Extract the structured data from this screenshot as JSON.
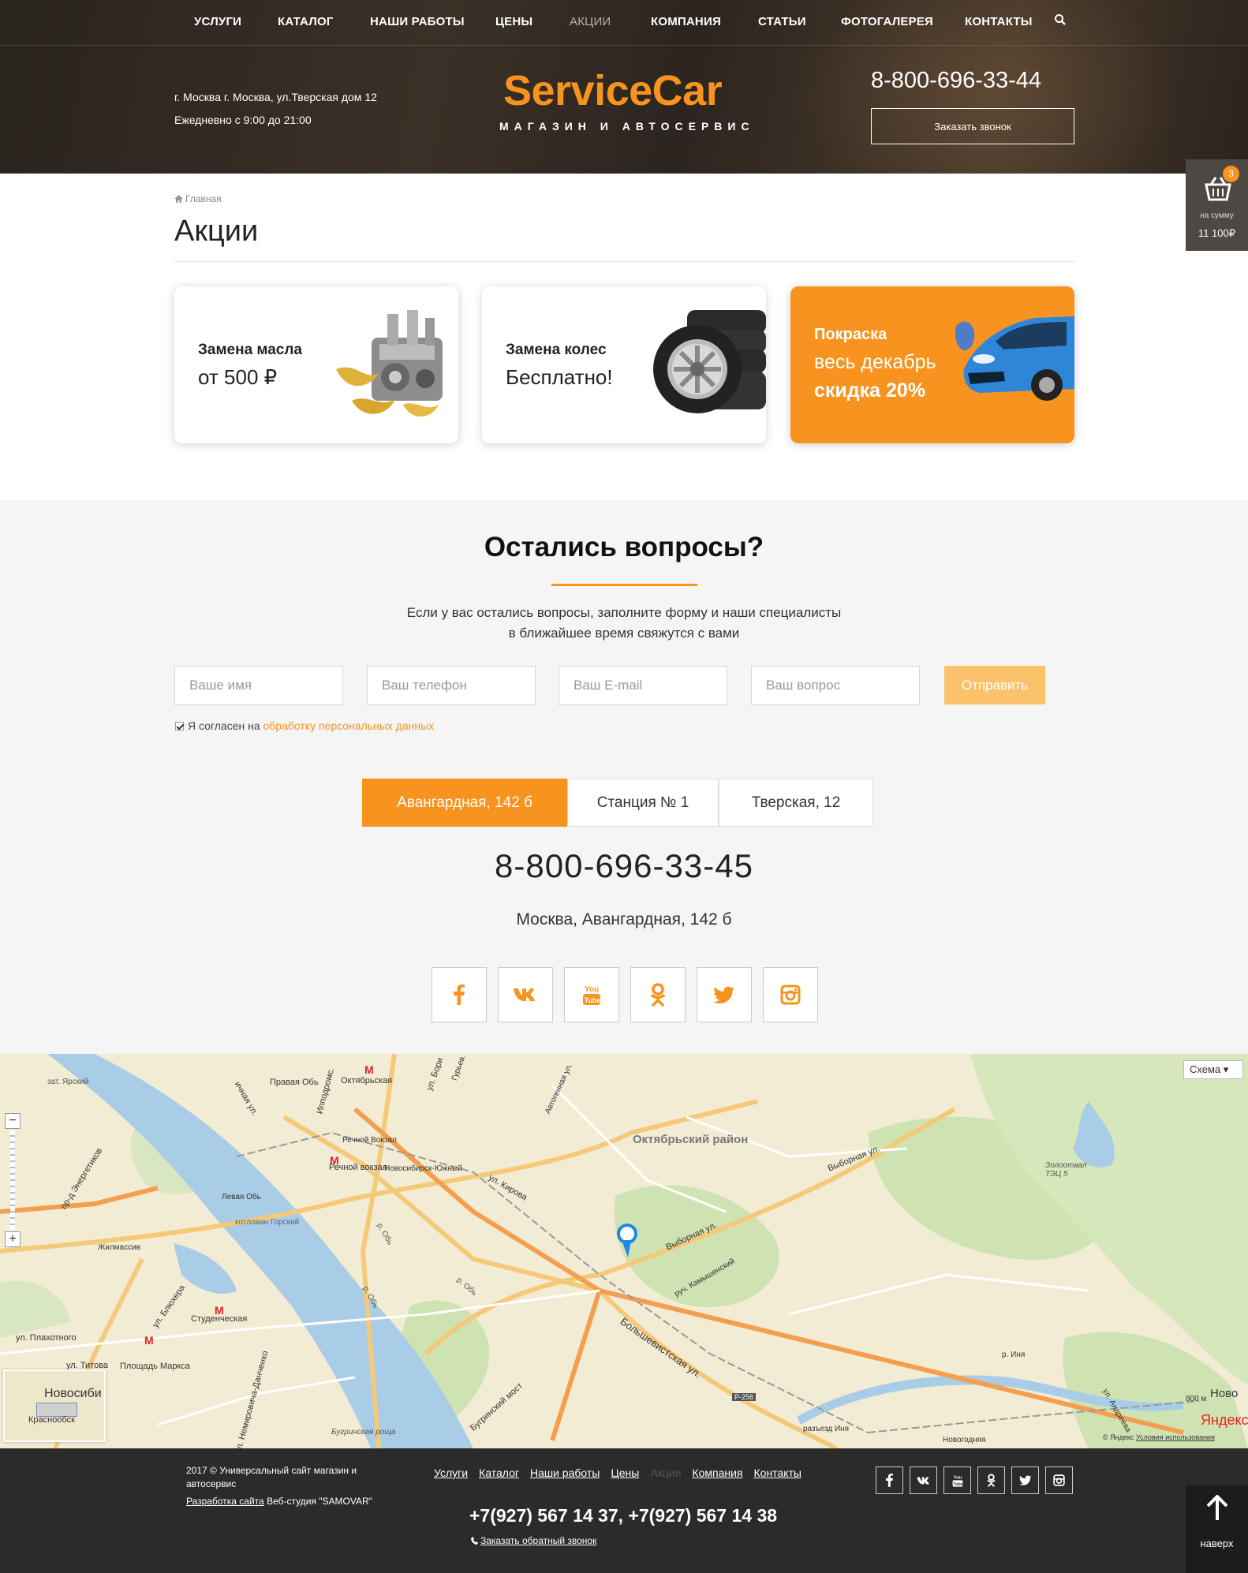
{
  "nav": {
    "items": [
      "УСЛУГИ",
      "КАТАЛОГ",
      "НАШИ РАБОТЫ",
      "ЦЕНЫ",
      "АКЦИИ",
      "КОМПАНИЯ",
      "СТАТЬИ",
      "ФОТОГАЛЕРЕЯ",
      "КОНТАКТЫ"
    ],
    "active": "АКЦИИ",
    "search_icon": "search-icon"
  },
  "header": {
    "address": "г. Москва г. Москва, ул.Тверская дом 12",
    "hours": "Ежедневно с 9:00 до 21:00",
    "logo": "ServiceCar",
    "logo_sub": "МАГАЗИН И АВТОСЕРВИС",
    "phone": "8-800-696-33-44",
    "call_button": "Заказать звонок"
  },
  "cart": {
    "count": "3",
    "label": "на сумму",
    "sum": "11 100₽",
    "icon": "basket-icon"
  },
  "breadcrumb": {
    "home": "Главная",
    "icon": "home-icon"
  },
  "page_title": "Акции",
  "promos": [
    {
      "title": "Замена масла",
      "text": "от 500 ₽",
      "image": "engine-oil-image"
    },
    {
      "title": "Замена колес",
      "text": "Бесплатно!",
      "image": "tires-image"
    },
    {
      "line1": "Покраска",
      "line2": "весь декабрь",
      "line3": "скидка 20%",
      "image": "blue-car-image",
      "color": "#f7931e"
    }
  ],
  "questions": {
    "title": "Остались вопросы?",
    "text_line1": "Если у вас остались вопросы, заполните форму и наши специалисты",
    "text_line2": "в ближайшее время свяжутся с вами",
    "placeholders": {
      "name": "Ваше имя",
      "phone": "Ваш телефон",
      "email": "Ваш E-mail",
      "question": "Ваш вопрос"
    },
    "send": "Отправить",
    "agree_text": "Я согласен на",
    "agree_link": "обработку персональных данных"
  },
  "contacts": {
    "tabs": [
      "Авангардная, 142 б",
      "Станция № 1",
      "Тверская, 12"
    ],
    "active_tab": 0,
    "phone": "8-800-696-33-45",
    "address": "Москва, Авангардная, 142 б",
    "socials": [
      "facebook-icon",
      "vk-icon",
      "youtube-icon",
      "odnoklassniki-icon",
      "twitter-icon",
      "instagram-icon"
    ]
  },
  "map": {
    "type_select": "Схема",
    "labels": {
      "district": "Октябрьский район",
      "oktyabrskaya": "Октябрьская",
      "rechnoy": "Речной вокзал",
      "rechnoy_small": "Речной Вокзал",
      "studencheskaya": "Студенческая",
      "ploshchad": "Площадь Маркса",
      "vybornaya1": "Выборная ул.",
      "vybornaya2": "Выборная ул.",
      "kirova": "ул. Кирова",
      "bolshevistskaya": "Большевистская ул.",
      "bugrinsky": "Бугринский мост",
      "levaya_ob": "Левая Обь",
      "yuzhny": "Новосибирск-Южный",
      "energetikov": "пр-д Энергетиков",
      "zhilmassiv": "Жилмассив",
      "titova": "ул. Титова",
      "plakhotnogo": "ул. Плахотного",
      "blyukhera": "ул. Блюхера",
      "nemirovicha": "ул. Немировича-Данченко",
      "inya": "р. Иня",
      "andreeva": "ул. Андреева",
      "tec5": "Золоотвал ТЭЦ 5",
      "novo_right": "Ново",
      "pravaya_ob": "Правая Обь",
      "kotlovan": "котлован Горский",
      "ob1": "р. Обь",
      "ob2": "р. Обь",
      "ob3": "р. Обь",
      "r256": "Р-256",
      "gurievskaya": "Гурьев.",
      "ippodromskaya": "Ипподромс.",
      "morskaya": "ул. Бори",
      "zatonny": "зат. Ярский",
      "komyshenskaya": "руч. Камышенский",
      "bugrinskaya_roshcha": "Бугринская роща",
      "razezd": "разъезд Иня",
      "novogodnyaya": "Новогодняя",
      "avtogennaya": "Автогенная ул.",
      "ichnaya": "ичная ул."
    },
    "minimap": {
      "title": "Новосиби",
      "sub": "Краснообск"
    },
    "scale": "800 м",
    "logo": "Яндекс",
    "copyright": "© Яндекс",
    "terms": "Условия использования"
  },
  "footer": {
    "copyright": "2017 © Универсальный сайт магазин и автосервис",
    "dev_link": "Разработка сайта",
    "dev_studio": "Веб-студия \"SAMOVAR\"",
    "links": [
      "Услуги",
      "Каталог",
      "Наши работы",
      "Цены",
      "Акции",
      "Компания",
      "Контакты"
    ],
    "dim_link": "Акции",
    "phones": "+7(927) 567 14 37, +7(927) 567 14 38",
    "callback": "Заказать обратный звонок",
    "to_top": "наверх"
  }
}
